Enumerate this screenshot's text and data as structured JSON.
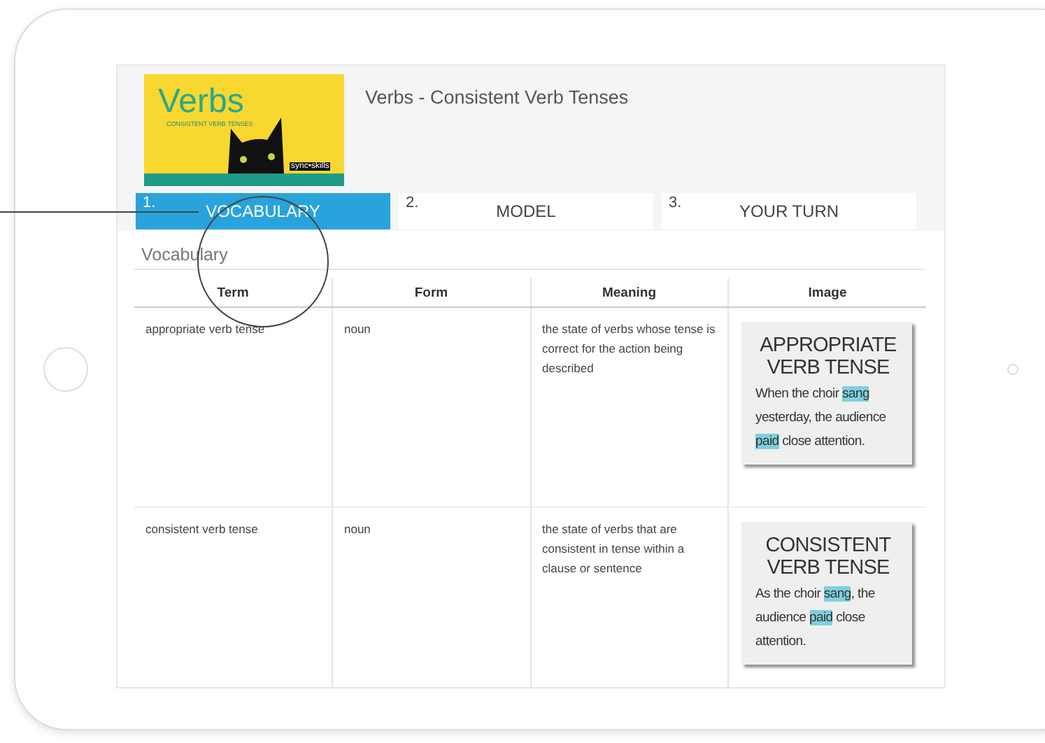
{
  "lesson": {
    "title": "Verbs - Consistent Verb Tenses",
    "thumbnail": {
      "heading": "Verbs",
      "subheading": "CONSISTENT VERB TENSES",
      "brand": "sync•skills"
    }
  },
  "tabs": [
    {
      "number": "1.",
      "label": "VOCABULARY",
      "selected": true
    },
    {
      "number": "2.",
      "label": "MODEL",
      "selected": false
    },
    {
      "number": "3.",
      "label": "YOUR TURN",
      "selected": false
    }
  ],
  "section_title": "Vocabulary",
  "table": {
    "columns": [
      "Term",
      "Form",
      "Meaning",
      "Image"
    ],
    "rows": [
      {
        "term": "appropriate verb tense",
        "form": "noun",
        "meaning": "the state of verbs whose tense is correct for the action being described",
        "card": {
          "title": "APPROPRIATE VERB TENSE",
          "segments": [
            {
              "text": "When the choir ",
              "highlighted": false
            },
            {
              "text": "sang",
              "highlighted": true
            },
            {
              "text": " yesterday, the audience ",
              "highlighted": false
            },
            {
              "text": "paid",
              "highlighted": true
            },
            {
              "text": " close attention.",
              "highlighted": false
            }
          ]
        }
      },
      {
        "term": "consistent verb tense",
        "form": "noun",
        "meaning": "the state of verbs that are consistent in tense within a clause or sentence",
        "card": {
          "title": "CONSISTENT VERB TENSE",
          "segments": [
            {
              "text": "As the choir ",
              "highlighted": false
            },
            {
              "text": "sang",
              "highlighted": true
            },
            {
              "text": ", the audience ",
              "highlighted": false
            },
            {
              "text": "paid",
              "highlighted": true
            },
            {
              "text": " close attention.",
              "highlighted": false
            }
          ]
        }
      }
    ]
  }
}
